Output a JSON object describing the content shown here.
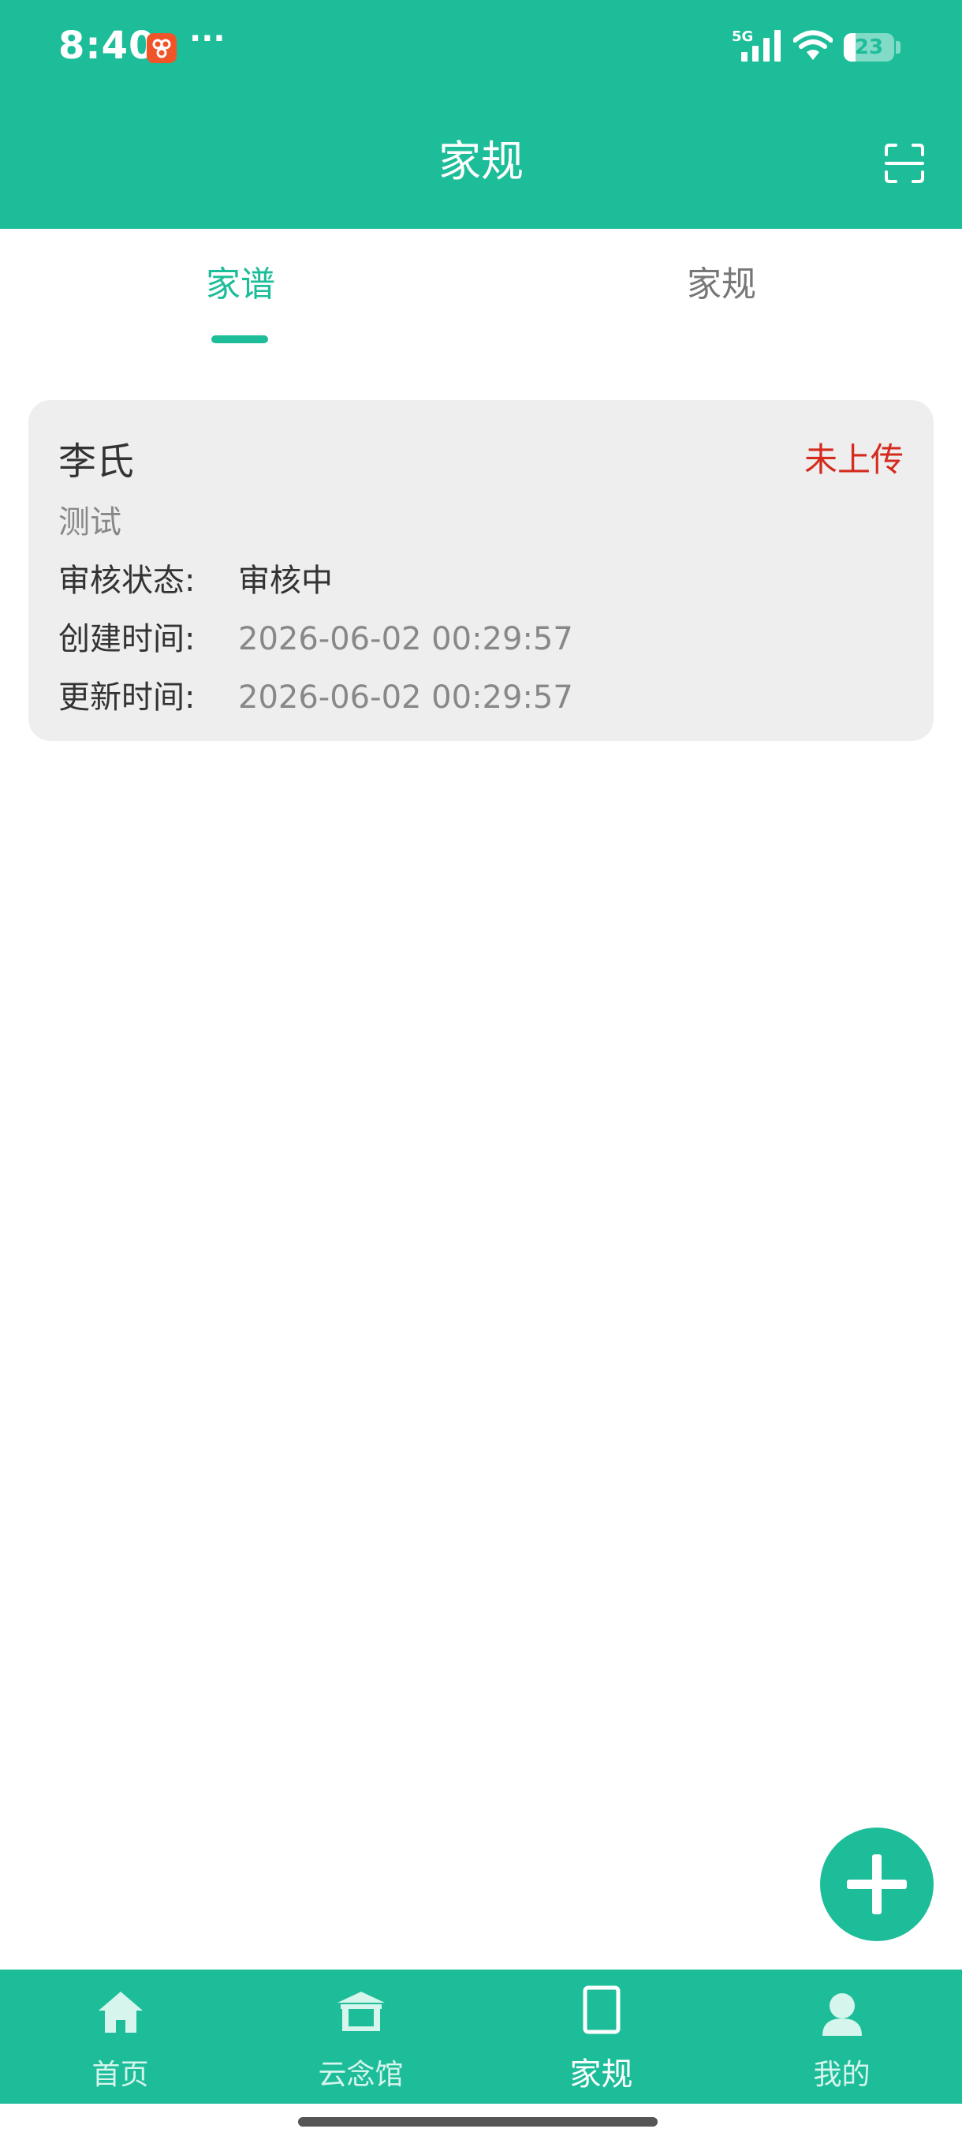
{
  "status_bar": {
    "time": "8:40",
    "more": "···",
    "network": "5G",
    "battery_level": 23,
    "battery_text": "23"
  },
  "nav_bar": {
    "title": "家规",
    "scan_icon": "scan-icon"
  },
  "tabs": [
    {
      "label": "家谱",
      "active": true
    },
    {
      "label": "家规",
      "active": false
    }
  ],
  "record": {
    "title": "李氏",
    "upload_status": "未上传",
    "subtitle": "测试",
    "review_label": "审核状态:",
    "review_value": "审核中",
    "created_label": "创建时间:",
    "created_value": "2026-06-02 00:29:57",
    "updated_label": "更新时间:",
    "updated_value": "2026-06-02 00:29:57"
  },
  "fab": {
    "icon": "plus-icon"
  },
  "bottom_nav": [
    {
      "label": "首页",
      "icon": "home-icon",
      "active": false
    },
    {
      "label": "云念馆",
      "icon": "memorial-hall-icon",
      "active": false
    },
    {
      "label": "家规",
      "icon": "book-icon",
      "active": true
    },
    {
      "label": "我的",
      "icon": "user-icon",
      "active": false
    }
  ],
  "colors": {
    "primary": "#1DBD9A",
    "status_red": "#D42B1E",
    "card_bg": "#EEEEEE"
  }
}
